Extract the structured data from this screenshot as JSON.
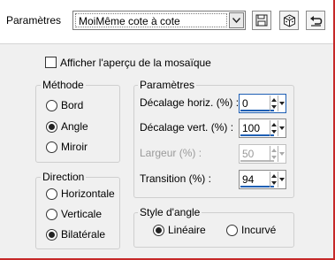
{
  "header": {
    "presets_label": "Paramètres",
    "preset_value": "MoiMême cote à cote"
  },
  "toolbar": {
    "save_icon": "floppy-disk-icon",
    "random_icon": "dice-icon",
    "reset_icon": "undo-arrow-icon"
  },
  "preview": {
    "label": "Afficher l'aperçu de la mosaïque",
    "checked": false
  },
  "method": {
    "title": "Méthode",
    "options": [
      {
        "label": "Bord",
        "selected": false
      },
      {
        "label": "Angle",
        "selected": true
      },
      {
        "label": "Miroir",
        "selected": false
      }
    ]
  },
  "direction": {
    "title": "Direction",
    "options": [
      {
        "label": "Horizontale",
        "selected": false
      },
      {
        "label": "Verticale",
        "selected": false
      },
      {
        "label": "Bilatérale",
        "selected": true
      }
    ]
  },
  "params": {
    "title": "Paramètres",
    "fields": [
      {
        "label": "Décalage horiz. (%) :",
        "value": "0",
        "enabled": true
      },
      {
        "label": "Décalage vert. (%) :",
        "value": "100",
        "enabled": true
      },
      {
        "label": "Largeur (%) :",
        "value": "50",
        "enabled": false
      },
      {
        "label": "Transition (%) :",
        "value": "94",
        "enabled": true
      }
    ]
  },
  "corner_style": {
    "title": "Style d'angle",
    "options": [
      {
        "label": "Linéaire",
        "selected": true
      },
      {
        "label": "Incurvé",
        "selected": false
      }
    ]
  },
  "colors": {
    "accent": "#1e5fb4",
    "frame": "#c62828"
  }
}
